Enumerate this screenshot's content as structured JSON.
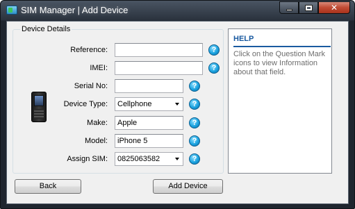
{
  "window": {
    "title": "SIM Manager | Add Device"
  },
  "caption_buttons": {
    "minimize_icon": "minimize-icon",
    "maximize_icon": "maximize-icon",
    "close_label": "✕"
  },
  "device_details": {
    "group_title": "Device Details",
    "device_icon": "cellphone-icon",
    "fields": {
      "reference": {
        "label": "Reference:",
        "value": ""
      },
      "imei": {
        "label": "IMEI:",
        "value": ""
      },
      "serial": {
        "label": "Serial No:",
        "value": ""
      },
      "device_type": {
        "label": "Device Type:",
        "value": "Cellphone"
      },
      "make": {
        "label": "Make:",
        "value": "Apple"
      },
      "model": {
        "label": "Model:",
        "value": "iPhone 5"
      },
      "assign_sim": {
        "label": "Assign SIM:",
        "value": "0825063582"
      }
    },
    "help_glyph": "?"
  },
  "buttons": {
    "back": "Back",
    "add_device": "Add Device"
  },
  "help_panel": {
    "title": "HELP",
    "text": "Click on the Question Mark icons to view Information about that field."
  },
  "colors": {
    "help_title": "#1a5aa0",
    "help_icon": "#1ba3e0",
    "close_button": "#c04a33"
  }
}
